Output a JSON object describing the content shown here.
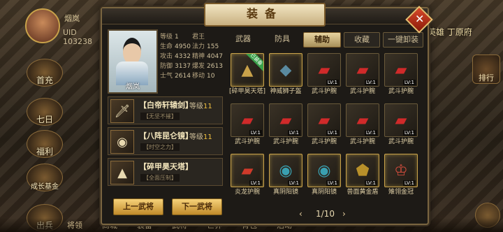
{
  "hud": {
    "player_name": "烟岚",
    "uid": "UID 103238",
    "hero_title": "亚英雄 丁原府",
    "rank_label": "排行",
    "side_buttons": [
      "首充",
      "七日",
      "福利",
      "成长基金",
      "出兵"
    ],
    "bottom_items": [
      "将领",
      "商城",
      "装备",
      "武将",
      "世界",
      "背包",
      "活动"
    ]
  },
  "panel": {
    "title": "装备",
    "close_label": "✕",
    "portrait_name": "烟岚",
    "stats": [
      [
        {
          "k": "等级",
          "v": "1"
        },
        {
          "k": "君王",
          "v": ""
        }
      ],
      [
        {
          "k": "生命",
          "v": "4950"
        },
        {
          "k": "法力",
          "v": "155"
        }
      ],
      [
        {
          "k": "攻击",
          "v": "4332"
        },
        {
          "k": "精神",
          "v": "4047"
        }
      ],
      [
        {
          "k": "防御",
          "v": "3137"
        },
        {
          "k": "爆发",
          "v": "2613"
        }
      ],
      [
        {
          "k": "士气",
          "v": "2614"
        },
        {
          "k": "移动",
          "v": "10"
        }
      ]
    ],
    "equipped": [
      {
        "name": "【白帝轩辕剑】",
        "level_label": "等级",
        "level": "11",
        "sub": "【无坚不摧】",
        "icon": "sword-icon"
      },
      {
        "name": "【八阵昆仑镜】",
        "level_label": "等级",
        "level": "11",
        "sub": "【时空之力】",
        "icon": "mirror-icon"
      },
      {
        "name": "【碎甲昊天塔】",
        "level_label": "",
        "level": "",
        "sub": "【全面压制】",
        "icon": "tower-icon"
      }
    ],
    "prev_button": "上一武将",
    "next_button": "下一武将",
    "tabs": [
      "武器",
      "防具",
      "辅助",
      "收藏",
      "一键卸装"
    ],
    "active_tab": "辅助",
    "items": [
      {
        "name": "[碎甲昊天塔]",
        "lv": "",
        "icon": "tower-icon",
        "equipped": "已装备",
        "gold": true
      },
      {
        "name": "神威狮子盔",
        "lv": "",
        "icon": "helmet-icon",
        "equipped": "",
        "gold": true
      },
      {
        "name": "武斗护腕",
        "lv": "LV:1",
        "icon": "bracer-icon",
        "equipped": "",
        "gold": false
      },
      {
        "name": "武斗护腕",
        "lv": "LV:1",
        "icon": "bracer-icon",
        "equipped": "",
        "gold": false
      },
      {
        "name": "武斗护腕",
        "lv": "LV:1",
        "icon": "bracer-icon",
        "equipped": "",
        "gold": false
      },
      {
        "name": "武斗护腕",
        "lv": "LV:1",
        "icon": "bracer-icon",
        "equipped": "",
        "gold": false
      },
      {
        "name": "武斗护腕",
        "lv": "LV:1",
        "icon": "bracer-icon",
        "equipped": "",
        "gold": false
      },
      {
        "name": "武斗护腕",
        "lv": "LV:1",
        "icon": "bracer-icon",
        "equipped": "",
        "gold": false
      },
      {
        "name": "武斗护腕",
        "lv": "LV:1",
        "icon": "bracer-icon",
        "equipped": "",
        "gold": false
      },
      {
        "name": "武斗护腕",
        "lv": "LV:1",
        "icon": "bracer-icon",
        "equipped": "",
        "gold": false
      },
      {
        "name": "炎龙护腕",
        "lv": "LV:1",
        "icon": "dragon-bracer-icon",
        "equipped": "",
        "gold": true
      },
      {
        "name": "真阴阳镜",
        "lv": "LV:1",
        "icon": "mirror-icon",
        "equipped": "",
        "gold": true
      },
      {
        "name": "真阴阳镜",
        "lv": "LV:1",
        "icon": "mirror-icon",
        "equipped": "",
        "gold": true
      },
      {
        "name": "兽面黄金盾",
        "lv": "LV:1",
        "icon": "shield-icon",
        "equipped": "",
        "gold": true
      },
      {
        "name": "雉翎金冠",
        "lv": "LV:1",
        "icon": "crown-icon",
        "equipped": "",
        "gold": true
      }
    ],
    "pager": {
      "prev": "‹",
      "text": "1/10",
      "next": "›"
    }
  }
}
